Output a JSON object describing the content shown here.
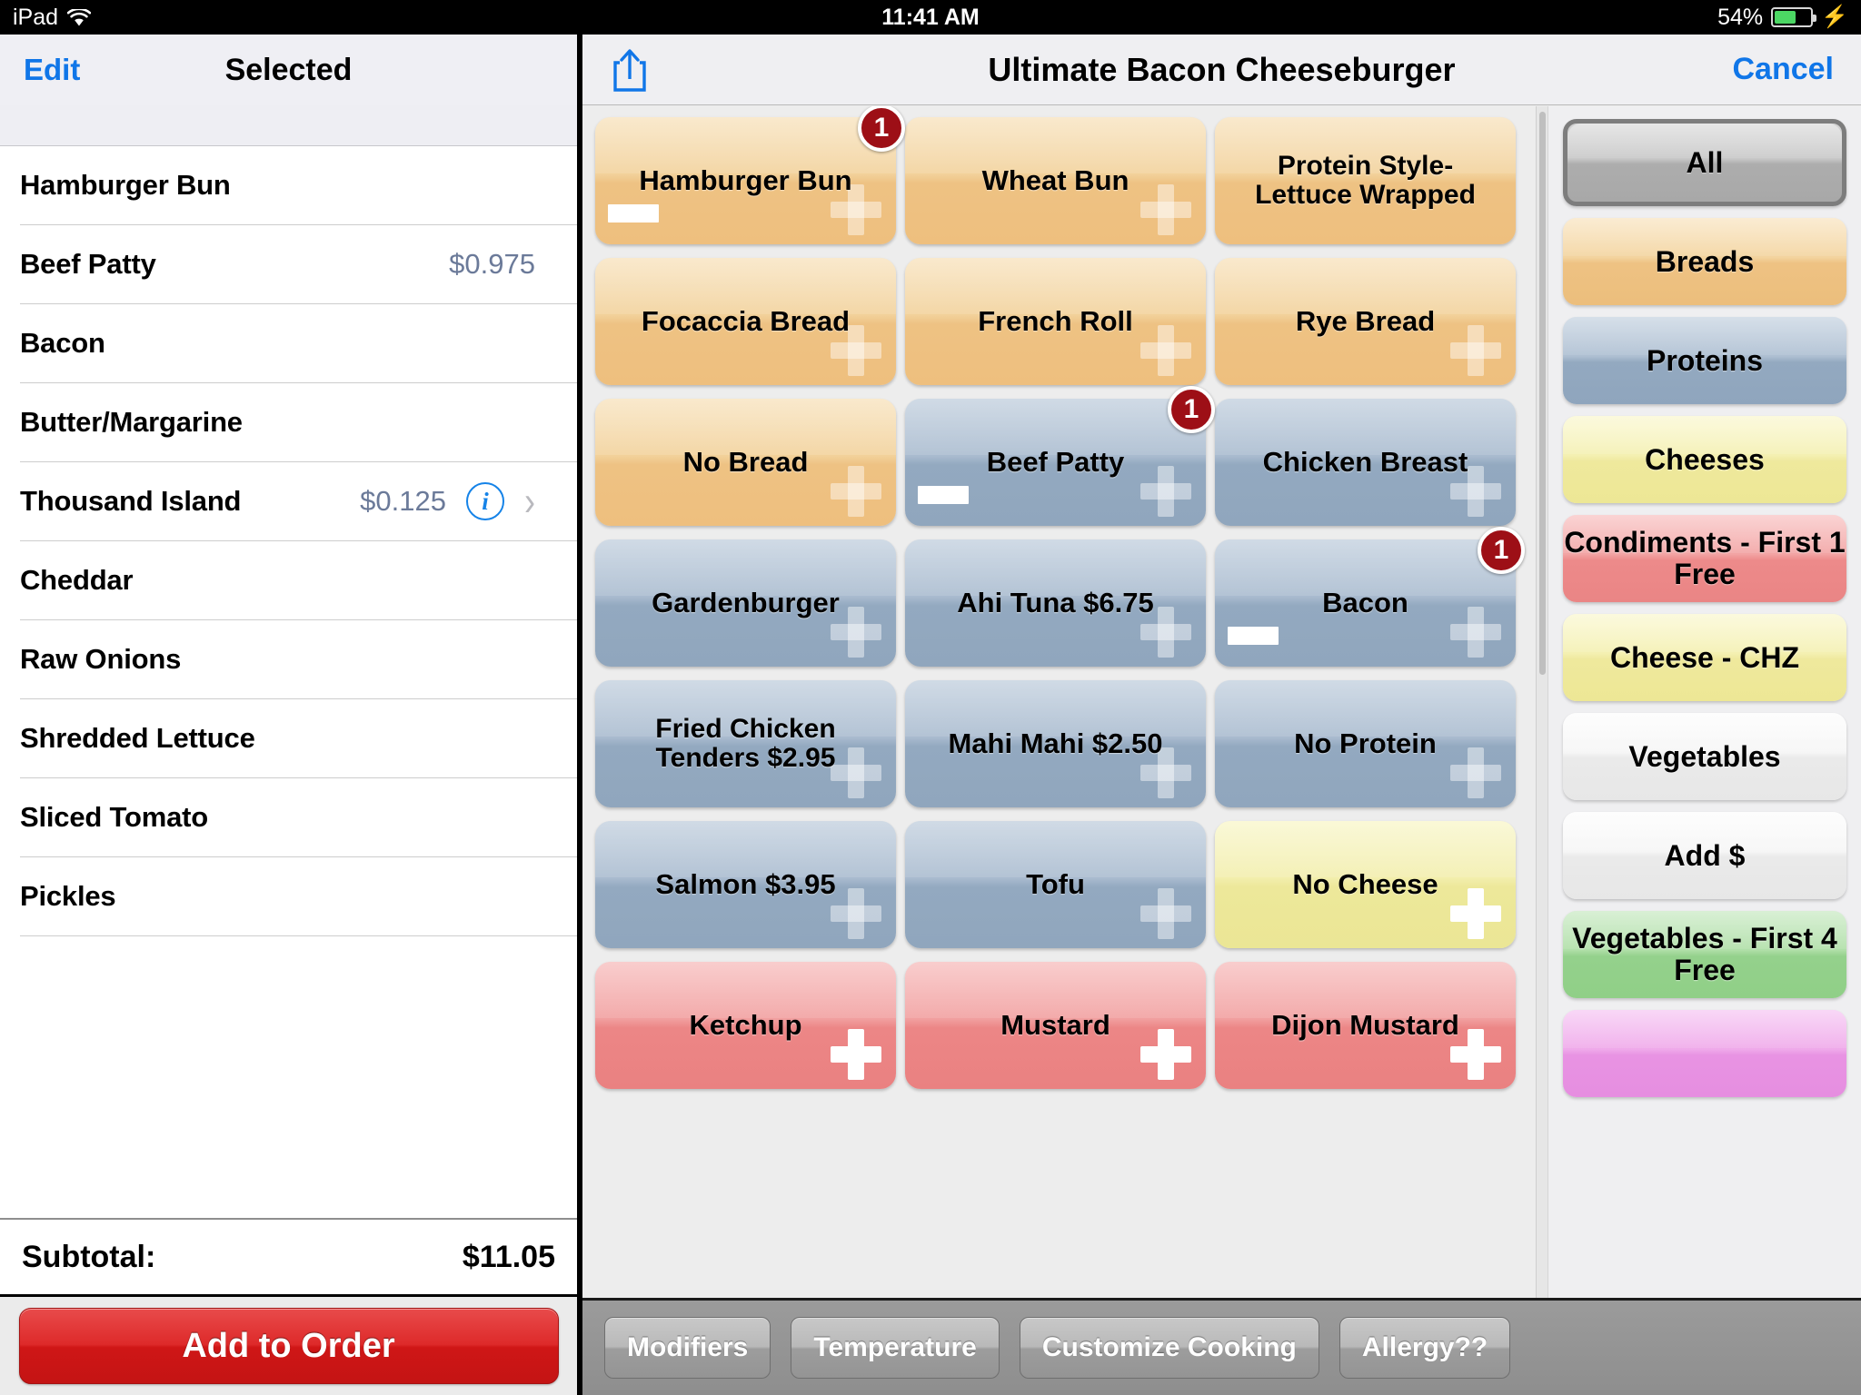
{
  "statusbar": {
    "device": "iPad",
    "wifi_icon": "wifi-icon",
    "time": "11:41 AM",
    "battery_percent": "54%",
    "battery_level": 54,
    "charging_icon": "lightning-bolt-icon"
  },
  "left_panel": {
    "edit_label": "Edit",
    "title": "Selected",
    "items": [
      {
        "name": "Hamburger Bun",
        "price": "",
        "has_info": false,
        "has_chevron": false
      },
      {
        "name": "Beef Patty",
        "price": "$0.975",
        "has_info": false,
        "has_chevron": false
      },
      {
        "name": "Bacon",
        "price": "",
        "has_info": false,
        "has_chevron": false
      },
      {
        "name": "Butter/Margarine",
        "price": "",
        "has_info": false,
        "has_chevron": false
      },
      {
        "name": "Thousand Island",
        "price": "$0.125",
        "has_info": true,
        "has_chevron": true
      },
      {
        "name": "Cheddar",
        "price": "",
        "has_info": false,
        "has_chevron": false
      },
      {
        "name": "Raw Onions",
        "price": "",
        "has_info": false,
        "has_chevron": false
      },
      {
        "name": "Shredded Lettuce",
        "price": "",
        "has_info": false,
        "has_chevron": false
      },
      {
        "name": "Sliced Tomato",
        "price": "",
        "has_info": false,
        "has_chevron": false
      },
      {
        "name": "Pickles",
        "price": "",
        "has_info": false,
        "has_chevron": false
      }
    ],
    "subtotal_label": "Subtotal:",
    "subtotal_value": "$11.05",
    "add_to_order_label": "Add to Order"
  },
  "right_panel": {
    "share_icon": "share-upload-icon",
    "title": "Ultimate Bacon Cheeseburger",
    "cancel_label": "Cancel"
  },
  "tiles": [
    {
      "label": "Hamburger Bun",
      "color": "bread",
      "badge": "1",
      "minus": true,
      "plus": "dim",
      "lines": 1
    },
    {
      "label": "Wheat Bun",
      "color": "bread",
      "badge": "",
      "minus": false,
      "plus": "dim",
      "lines": 1
    },
    {
      "label": "Protein Style-Lettuce Wrapped",
      "color": "bread",
      "badge": "",
      "minus": false,
      "plus": "none",
      "lines": 2
    },
    {
      "label": "Focaccia Bread",
      "color": "bread",
      "badge": "",
      "minus": false,
      "plus": "dim",
      "lines": 1
    },
    {
      "label": "French Roll",
      "color": "bread",
      "badge": "",
      "minus": false,
      "plus": "dim",
      "lines": 1
    },
    {
      "label": "Rye Bread",
      "color": "bread",
      "badge": "",
      "minus": false,
      "plus": "dim",
      "lines": 1
    },
    {
      "label": "No Bread",
      "color": "bread",
      "badge": "",
      "minus": false,
      "plus": "dim",
      "lines": 1
    },
    {
      "label": "Beef Patty",
      "color": "protein",
      "badge": "1",
      "minus": true,
      "plus": "dim",
      "lines": 1
    },
    {
      "label": "Chicken Breast",
      "color": "protein",
      "badge": "",
      "minus": false,
      "plus": "dim",
      "lines": 1
    },
    {
      "label": "Gardenburger",
      "color": "protein",
      "badge": "",
      "minus": false,
      "plus": "dim",
      "lines": 1
    },
    {
      "label": "Ahi Tuna $6.75",
      "color": "protein",
      "badge": "",
      "minus": false,
      "plus": "dim",
      "lines": 1
    },
    {
      "label": "Bacon",
      "color": "protein",
      "badge": "1",
      "minus": true,
      "plus": "dim",
      "lines": 1
    },
    {
      "label": "Fried Chicken Tenders $2.95",
      "color": "protein",
      "badge": "",
      "minus": false,
      "plus": "dim",
      "lines": 2
    },
    {
      "label": "Mahi  Mahi $2.50",
      "color": "protein",
      "badge": "",
      "minus": false,
      "plus": "dim",
      "lines": 1
    },
    {
      "label": "No Protein",
      "color": "protein",
      "badge": "",
      "minus": false,
      "plus": "dim",
      "lines": 1
    },
    {
      "label": "Salmon $3.95",
      "color": "protein",
      "badge": "",
      "minus": false,
      "plus": "dim",
      "lines": 1
    },
    {
      "label": "Tofu",
      "color": "protein",
      "badge": "",
      "minus": false,
      "plus": "dim",
      "lines": 1
    },
    {
      "label": "No Cheese",
      "color": "cheese",
      "badge": "",
      "minus": false,
      "plus": "bright",
      "lines": 1
    },
    {
      "label": "Ketchup",
      "color": "cond",
      "badge": "",
      "minus": false,
      "plus": "bright",
      "lines": 1
    },
    {
      "label": "Mustard",
      "color": "cond",
      "badge": "",
      "minus": false,
      "plus": "bright",
      "lines": 1
    },
    {
      "label": "Dijon Mustard",
      "color": "cond",
      "badge": "",
      "minus": false,
      "plus": "bright",
      "lines": 1
    }
  ],
  "categories": [
    {
      "label": "All",
      "style": "sel",
      "selected": true
    },
    {
      "label": "Breads",
      "style": "bread",
      "selected": false
    },
    {
      "label": "Proteins",
      "style": "protein",
      "selected": false
    },
    {
      "label": "Cheeses",
      "style": "cheese",
      "selected": false
    },
    {
      "label": "Condiments - First 1 Free",
      "style": "cond",
      "selected": false
    },
    {
      "label": "Cheese - CHZ",
      "style": "cheese",
      "selected": false
    },
    {
      "label": "Vegetables",
      "style": "white",
      "selected": false
    },
    {
      "label": "Add $",
      "style": "white",
      "selected": false
    },
    {
      "label": "Vegetables - First 4 Free",
      "style": "green",
      "selected": false
    },
    {
      "label": "",
      "style": "pink",
      "selected": false
    }
  ],
  "toolbar": {
    "buttons": [
      {
        "label": "Modifiers"
      },
      {
        "label": "Temperature"
      },
      {
        "label": "Customize Cooking"
      },
      {
        "label": "Allergy??"
      }
    ]
  },
  "colors": {
    "accent_blue": "#1076e8",
    "badge_red": "#9d0f16",
    "add_order_red": "#cf1616",
    "bread": "#eec283",
    "protein": "#93a9c0",
    "cheese": "#ede89a",
    "condiment": "#ec8686",
    "green": "#94d18c",
    "pink": "#e893e3"
  }
}
